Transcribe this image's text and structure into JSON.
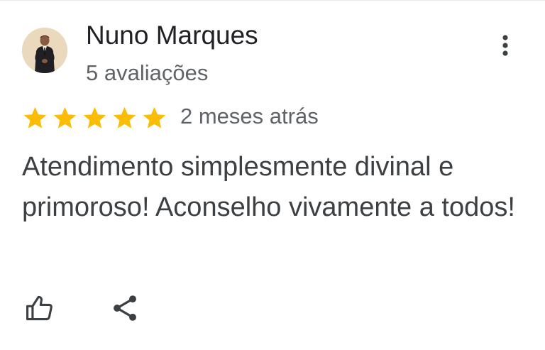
{
  "review": {
    "author_name": "Nuno Marques",
    "review_count": "5 avaliações",
    "rating": 5,
    "rating_max": 5,
    "time_ago": "2 meses atrás",
    "text": "Atendimento simplesmente divinal e primoroso! Aconselho vivamente a todos!"
  },
  "icons": {
    "avatar": "avatar-photo",
    "more": "more-vert-icon",
    "star": "star-icon",
    "like": "thumb-up-icon",
    "share": "share-icon"
  },
  "colors": {
    "star": "#fbbc04",
    "primary_text": "#202124",
    "secondary_text": "#5f6368",
    "body_text": "#3c4043",
    "icon": "#3c4043"
  }
}
